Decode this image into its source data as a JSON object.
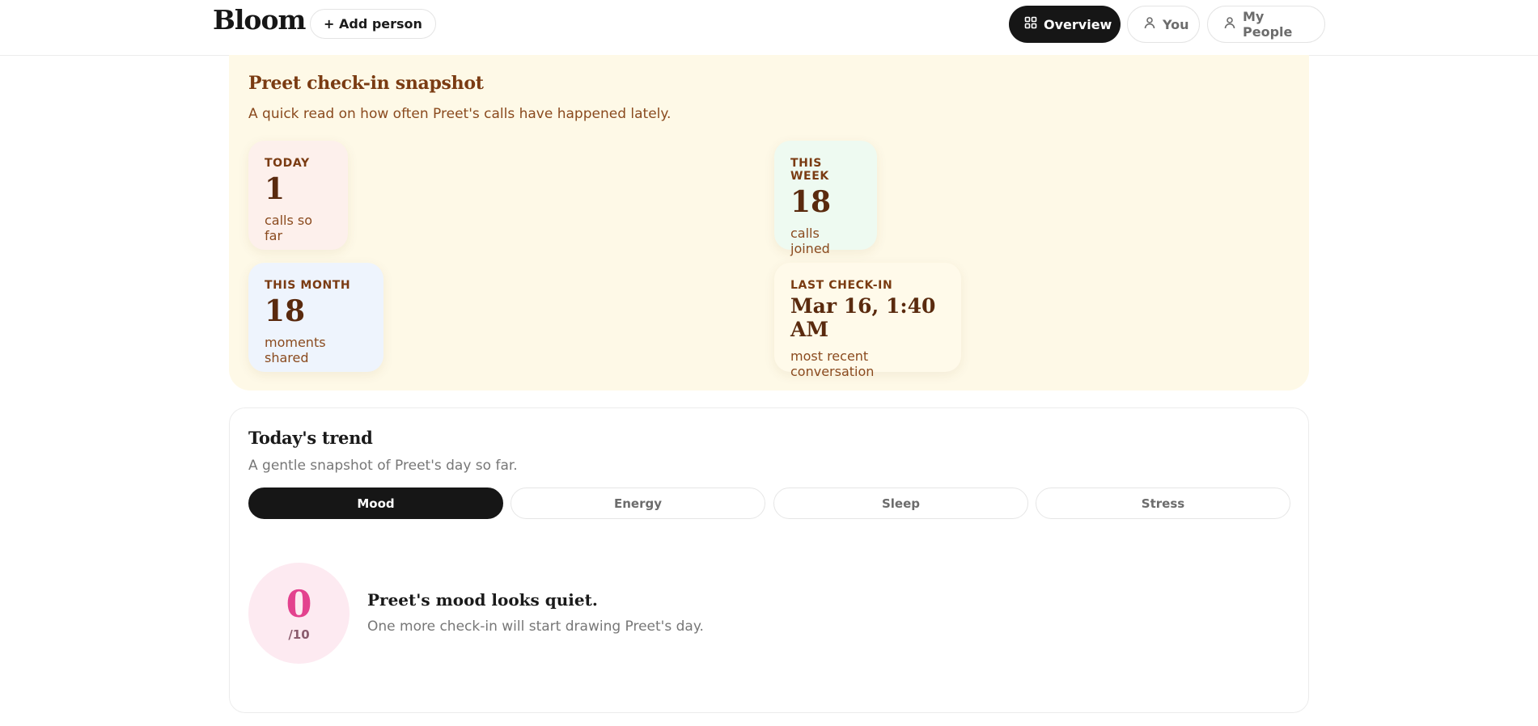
{
  "header": {
    "logo": "Bloom",
    "add_person_label": "+ Add person",
    "nav": [
      {
        "label": "Overview",
        "icon": "grid-icon",
        "active": true
      },
      {
        "label": "You",
        "icon": "person-icon",
        "active": false
      },
      {
        "label": "My People",
        "icon": "person-icon",
        "active": false
      }
    ]
  },
  "snapshot": {
    "title": "Preet check-in snapshot",
    "subtitle": "A quick read on how often Preet's calls have happened lately.",
    "stats": {
      "today": {
        "label": "TODAY",
        "value": "1",
        "note": "calls so far"
      },
      "week": {
        "label": "THIS WEEK",
        "value": "18",
        "note": "calls joined"
      },
      "month": {
        "label": "THIS MONTH",
        "value": "18",
        "note": "moments shared"
      },
      "last": {
        "label": "LAST CHECK-IN",
        "value": "Mar 16, 1:40 AM",
        "note": "most recent conversation"
      }
    }
  },
  "trend": {
    "title": "Today's trend",
    "subtitle": "A gentle snapshot of Preet's day so far.",
    "tabs": [
      {
        "label": "Mood",
        "active": true
      },
      {
        "label": "Energy",
        "active": false
      },
      {
        "label": "Sleep",
        "active": false
      },
      {
        "label": "Stress",
        "active": false
      }
    ],
    "score": {
      "value": "0",
      "scale": "/10"
    },
    "message_title": "Preet's mood looks quiet.",
    "message_sub": "One more check-in will start drawing Preet's day."
  },
  "colors": {
    "snapshot_bg": "#fef9e7",
    "accent_text": "#7a3b12",
    "score_pink": "#e3428e",
    "active_pill": "#161616"
  }
}
